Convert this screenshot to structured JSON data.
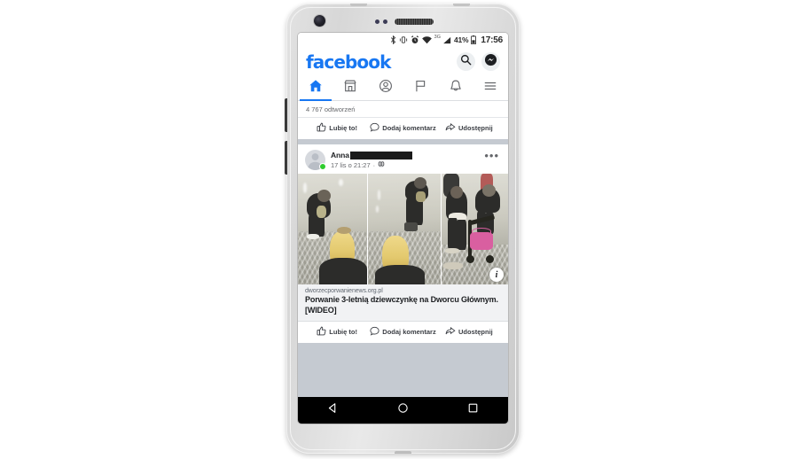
{
  "device": {
    "hardware": {
      "front_camera": "front-camera",
      "sensors": "proximity-sensors",
      "earpiece": "earpiece-speaker",
      "volume_up": "volume-up-button",
      "volume_down": "volume-down-button"
    }
  },
  "status_bar": {
    "icons": [
      "bluetooth",
      "vibrate",
      "alarm",
      "wifi",
      "signal"
    ],
    "network_type": "3G",
    "battery_percent": "41%",
    "clock": "17:56"
  },
  "fb_header": {
    "wordmark": "facebook",
    "search_icon": "search-icon",
    "messenger_icon": "messenger-icon"
  },
  "fb_tabs": [
    {
      "id": "home",
      "icon": "home-icon",
      "active": true
    },
    {
      "id": "marketplace",
      "icon": "marketplace-icon",
      "active": false
    },
    {
      "id": "profile",
      "icon": "profile-icon",
      "active": false
    },
    {
      "id": "pages",
      "icon": "flag-icon",
      "active": false
    },
    {
      "id": "notifications",
      "icon": "bell-icon",
      "active": false
    },
    {
      "id": "menu",
      "icon": "hamburger-menu-icon",
      "active": false
    }
  ],
  "previous_post": {
    "views": "4 767 odtworzeń",
    "actions": {
      "like": "Lubię to!",
      "comment": "Dodaj komentarz",
      "share": "Udostępnij"
    }
  },
  "post": {
    "author_name": "Anna",
    "author_redacted": true,
    "timestamp": "17 lis o 21:27",
    "privacy_icon": "globe-icon",
    "menu": "•••",
    "media": {
      "type": "cctv-collage",
      "panels": 3,
      "info_badge": "i"
    },
    "link_preview": {
      "domain": "dworzecporwanienews.org.pl",
      "title": "Porwanie 3-letnią dziewczynkę na Dworcu Głównym. [WIDEO]"
    },
    "actions": {
      "like": "Lubię to!",
      "comment": "Dodaj komentarz",
      "share": "Udostępnij"
    }
  },
  "android_nav": {
    "back": "back-triangle-icon",
    "home": "home-circle-icon",
    "recents": "recents-square-icon"
  },
  "colors": {
    "facebook_blue": "#1877f2",
    "feed_bg": "#c5cad1",
    "online_green": "#2ecc2e",
    "text_primary": "#1c1e21",
    "text_secondary": "#65676b"
  }
}
